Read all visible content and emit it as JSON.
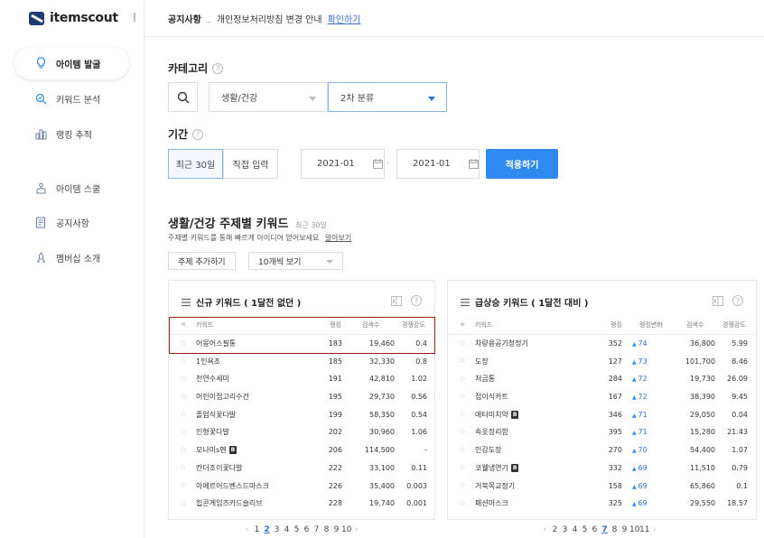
{
  "brand": {
    "name": "itemscout"
  },
  "nav": [
    {
      "label": "아이템 발굴",
      "icon": "lightbulb-icon"
    },
    {
      "label": "키워드 분석",
      "icon": "search-chart-icon"
    },
    {
      "label": "랭킹 추적",
      "icon": "bar-chart-icon"
    },
    {
      "label": "아이템 스쿨",
      "icon": "school-icon"
    },
    {
      "label": "공지사항",
      "icon": "document-icon"
    },
    {
      "label": "멤버십 소개",
      "icon": "rocket-icon"
    }
  ],
  "notice": {
    "tag": "공지사항",
    "sep": "_",
    "text": "개인정보처리방침 변경 안내",
    "link": "확인하기"
  },
  "category": {
    "label": "카테고리",
    "first": "생활/건강",
    "second": "2차 분류"
  },
  "period": {
    "label": "기간",
    "recent": "최근 30일",
    "custom": "직접 입력",
    "start": "2021-01",
    "end": "2021-01",
    "dash": "-",
    "apply": "적용하기"
  },
  "themes": {
    "title": "생활/건강",
    "title_suffix": "주제별 키워드",
    "sub": "최근 30일",
    "desc": "주제별 키워드를 통해 빠르게 아이디어 얻어보세요",
    "more": "알아보기",
    "add_btn": "주제 추가하기",
    "view_select": "10개씩 보기"
  },
  "new_panel": {
    "title": "신규 키워드 ( 1달전 없던 )",
    "headers": {
      "keyword": "키워드",
      "rank": "랭킹",
      "search": "검색수",
      "comp": "경쟁강도"
    },
    "rows": [
      {
        "keyword": "어몽어스필통",
        "rank": "183",
        "search": "19,460",
        "comp": "0.4",
        "badge": ""
      },
      {
        "keyword": "1인욕조",
        "rank": "185",
        "search": "32,330",
        "comp": "0.8",
        "badge": ""
      },
      {
        "keyword": "천연수세미",
        "rank": "191",
        "search": "42,810",
        "comp": "1.02",
        "badge": ""
      },
      {
        "keyword": "어린이접고리수건",
        "rank": "195",
        "search": "29,730",
        "comp": "0.56",
        "badge": ""
      },
      {
        "keyword": "졸업식꽃다발",
        "rank": "199",
        "search": "58,350",
        "comp": "0.54",
        "badge": ""
      },
      {
        "keyword": "인형꽃다발",
        "rank": "202",
        "search": "30,960",
        "comp": "1.06",
        "badge": ""
      },
      {
        "keyword": "모나미s펜",
        "rank": "206",
        "search": "114,500",
        "comp": "-",
        "badge": "B"
      },
      {
        "keyword": "칸더조이꽃다발",
        "rank": "222",
        "search": "33,100",
        "comp": "0.11",
        "badge": ""
      },
      {
        "keyword": "아에르어드벤스드마스크",
        "rank": "226",
        "search": "35,400",
        "comp": "0.003",
        "badge": ""
      },
      {
        "keyword": "힙콘게임즈카드슬리브",
        "rank": "228",
        "search": "19,740",
        "comp": "0.001",
        "badge": ""
      }
    ],
    "pages": [
      "1",
      "2",
      "3",
      "4",
      "5",
      "6",
      "7",
      "8",
      "9",
      "10"
    ],
    "current_page": "2"
  },
  "rising_panel": {
    "title": "급상승 키워드 ( 1달전 대비 )",
    "headers": {
      "keyword": "키워드",
      "rank": "랭킹",
      "change": "랭킹변화",
      "search": "검색수",
      "comp": "경쟁강도"
    },
    "rows": [
      {
        "keyword": "차량용공기청정기",
        "rank": "352",
        "change": "74",
        "search": "36,800",
        "comp": "5.99",
        "badge": ""
      },
      {
        "keyword": "도장",
        "rank": "127",
        "change": "73",
        "search": "101,700",
        "comp": "8.46",
        "badge": ""
      },
      {
        "keyword": "저금통",
        "rank": "284",
        "change": "72",
        "search": "19,730",
        "comp": "26.09",
        "badge": ""
      },
      {
        "keyword": "접이식카트",
        "rank": "167",
        "change": "72",
        "search": "38,390",
        "comp": "9.45",
        "badge": ""
      },
      {
        "keyword": "애터미치약",
        "rank": "346",
        "change": "71",
        "search": "29,050",
        "comp": "0.04",
        "badge": "B"
      },
      {
        "keyword": "속옷정리함",
        "rank": "395",
        "change": "71",
        "search": "15,280",
        "comp": "21.43",
        "badge": ""
      },
      {
        "keyword": "인감도장",
        "rank": "270",
        "change": "70",
        "search": "54,400",
        "comp": "1.07",
        "badge": ""
      },
      {
        "keyword": "코웰냉연기",
        "rank": "332",
        "change": "69",
        "search": "11,510",
        "comp": "0.79",
        "badge": "B"
      },
      {
        "keyword": "거북목교정기",
        "rank": "158",
        "change": "69",
        "search": "65,860",
        "comp": "0.1",
        "badge": ""
      },
      {
        "keyword": "패션마스크",
        "rank": "325",
        "change": "69",
        "search": "29,550",
        "comp": "18.57",
        "badge": ""
      }
    ],
    "pages": [
      "2",
      "3",
      "4",
      "5",
      "6",
      "7",
      "8",
      "9",
      "10",
      "11"
    ],
    "current_page": "7"
  },
  "colors": {
    "accent": "#2e8af0",
    "highlight": "#9b1c1c"
  }
}
